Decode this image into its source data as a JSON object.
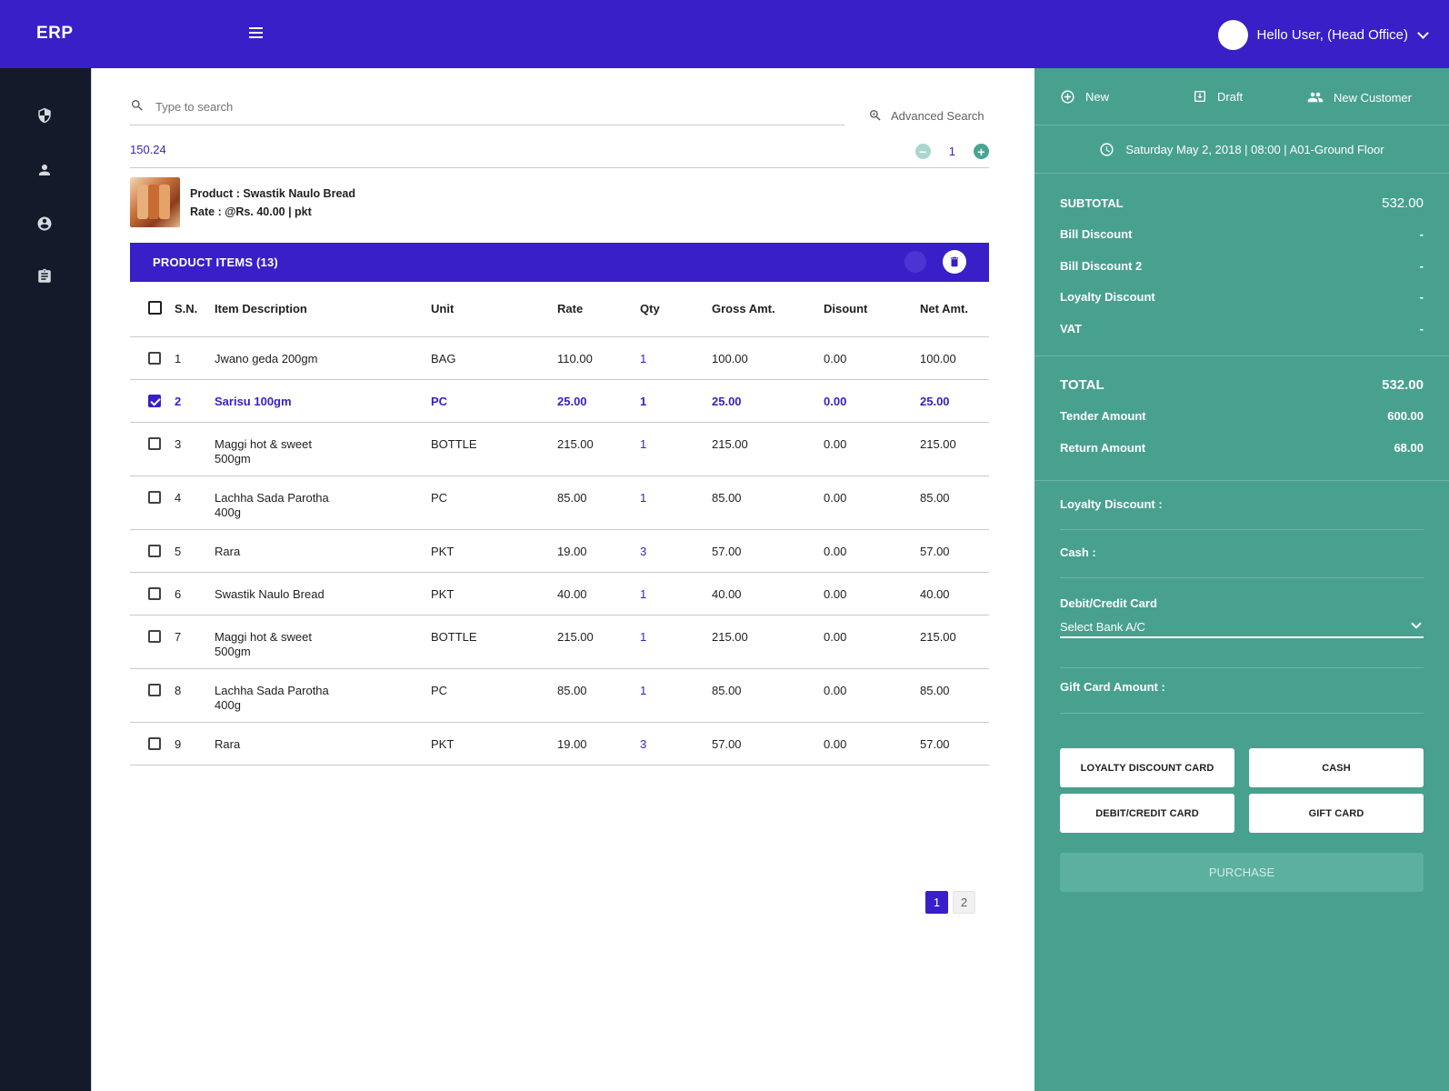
{
  "header": {
    "brand": "ERP",
    "user_greeting": "Hello User, (Head Office)"
  },
  "sidebar": {
    "icons": [
      "shield-icon",
      "person-icon",
      "account-circle-icon",
      "clipboard-icon"
    ]
  },
  "search": {
    "placeholder": "Type to search",
    "advanced_label": "Advanced Search"
  },
  "current": {
    "amount": "150.24",
    "qty": "1",
    "product_line": "Product : Swastik Naulo Bread",
    "rate_line": "Rate : @Rs. 40.00 | pkt"
  },
  "items_panel": {
    "title": "PRODUCT ITEMS (13)",
    "columns": [
      "S.N.",
      "Item Description",
      "Unit",
      "Rate",
      "Qty",
      "Gross Amt.",
      "Disount",
      "Net Amt."
    ],
    "rows": [
      {
        "sn": "1",
        "desc": "Jwano geda 200gm",
        "unit": "BAG",
        "rate": "110.00",
        "qty": "1",
        "gross": "100.00",
        "disc": "0.00",
        "net": "100.00",
        "checked": false
      },
      {
        "sn": "2",
        "desc": "Sarisu 100gm",
        "unit": "PC",
        "rate": "25.00",
        "qty": "1",
        "gross": "25.00",
        "disc": "0.00",
        "net": "25.00",
        "checked": true
      },
      {
        "sn": "3",
        "desc": "Maggi hot & sweet 500gm",
        "unit": "BOTTLE",
        "rate": "215.00",
        "qty": "1",
        "gross": "215.00",
        "disc": "0.00",
        "net": "215.00",
        "checked": false
      },
      {
        "sn": "4",
        "desc": "Lachha Sada Parotha 400g",
        "unit": "PC",
        "rate": "85.00",
        "qty": "1",
        "gross": "85.00",
        "disc": "0.00",
        "net": "85.00",
        "checked": false
      },
      {
        "sn": "5",
        "desc": "Rara",
        "unit": "PKT",
        "rate": "19.00",
        "qty": "3",
        "gross": "57.00",
        "disc": "0.00",
        "net": "57.00",
        "checked": false
      },
      {
        "sn": "6",
        "desc": "Swastik Naulo Bread",
        "unit": "PKT",
        "rate": "40.00",
        "qty": "1",
        "gross": "40.00",
        "disc": "0.00",
        "net": "40.00",
        "checked": false
      },
      {
        "sn": "7",
        "desc": "Maggi hot & sweet 500gm",
        "unit": "BOTTLE",
        "rate": "215.00",
        "qty": "1",
        "gross": "215.00",
        "disc": "0.00",
        "net": "215.00",
        "checked": false
      },
      {
        "sn": "8",
        "desc": "Lachha Sada Parotha 400g",
        "unit": "PC",
        "rate": "85.00",
        "qty": "1",
        "gross": "85.00",
        "disc": "0.00",
        "net": "85.00",
        "checked": false
      },
      {
        "sn": "9",
        "desc": "Rara",
        "unit": "PKT",
        "rate": "19.00",
        "qty": "3",
        "gross": "57.00",
        "disc": "0.00",
        "net": "57.00",
        "checked": false
      }
    ]
  },
  "pagination": {
    "pages": [
      "1",
      "2"
    ],
    "active": "1"
  },
  "right_panel": {
    "actions": {
      "new": "New",
      "draft": "Draft",
      "new_customer": "New Customer"
    },
    "datetime": "Saturday May 2, 2018 | 08:00 | A01-Ground Floor",
    "summary": [
      {
        "label": "SUBTOTAL",
        "value": "532.00"
      },
      {
        "label": "Bill Discount",
        "value": "-"
      },
      {
        "label": "Bill Discount 2",
        "value": "-"
      },
      {
        "label": "Loyalty Discount",
        "value": "-"
      },
      {
        "label": "VAT",
        "value": "-"
      }
    ],
    "totals": [
      {
        "label": "TOTAL",
        "value": "532.00"
      },
      {
        "label": "Tender Amount",
        "value": "600.00"
      },
      {
        "label": "Return Amount",
        "value": "68.00"
      }
    ],
    "payment": {
      "loyalty_label": "Loyalty Discount :",
      "cash_label": "Cash :",
      "card_label": "Debit/Credit Card",
      "bank_placeholder": "Select Bank A/C",
      "gift_label": "Gift Card Amount :"
    },
    "buttons": {
      "loyalty": "LOYALTY DISCOUNT CARD",
      "cash": "CASH",
      "card": "DEBIT/CREDIT CARD",
      "gift": "GIFT CARD",
      "purchase": "PURCHASE"
    }
  },
  "colors": {
    "primary": "#381fc7",
    "accent": "#48a18f",
    "sidebar": "#141a29"
  }
}
